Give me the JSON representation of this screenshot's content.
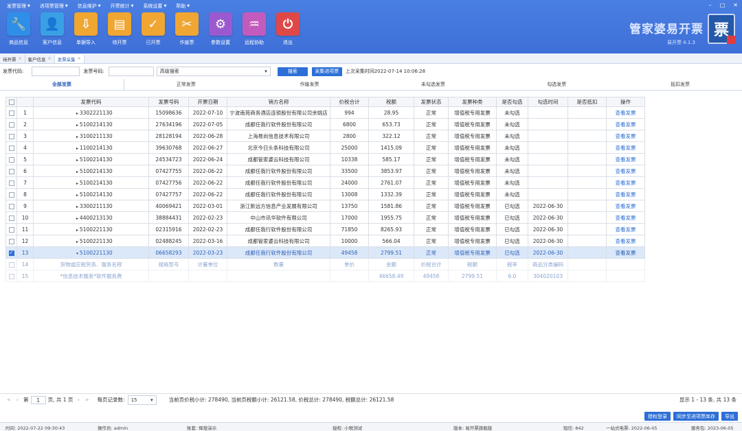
{
  "menu": [
    "发票管理",
    "进项票管理",
    "信息维护",
    "开票统计",
    "系统设置",
    "帮助"
  ],
  "window_controls": [
    "–",
    "□",
    "✕"
  ],
  "toolbar": [
    {
      "label": "商品信息",
      "icon": "wrench-icon",
      "glyph": "🔧",
      "color": "#2f8fe8"
    },
    {
      "label": "客户信息",
      "icon": "user-icon",
      "glyph": "👤",
      "color": "#3aa0e6"
    },
    {
      "label": "单据导入",
      "icon": "import-icon",
      "glyph": "⇩",
      "color": "#f0a632"
    },
    {
      "label": "待开票",
      "icon": "document-icon",
      "glyph": "▤",
      "color": "#f0a632"
    },
    {
      "label": "已开票",
      "icon": "check-icon",
      "glyph": "✓",
      "color": "#f0a632"
    },
    {
      "label": "作废票",
      "icon": "void-icon",
      "glyph": "✂",
      "color": "#f0a632"
    },
    {
      "label": "参数设置",
      "icon": "gear-icon",
      "glyph": "⚙",
      "color": "#9b59d0"
    },
    {
      "label": "远程协助",
      "icon": "monitor-icon",
      "glyph": "♒",
      "color": "#c25bbd"
    },
    {
      "label": "退出",
      "icon": "power-icon",
      "glyph": "⏻",
      "color": "#e04848"
    }
  ],
  "brand": {
    "title": "管家婆易开票",
    "sub": "易开票  4.1.3",
    "logo": "票"
  },
  "tabs": [
    "待开票",
    "客户信息",
    "发票采集"
  ],
  "filter": {
    "code_label": "发票代码:",
    "number_label": "发票号码:",
    "search_mode": "高级搜索",
    "search_btn": "搜索",
    "collect_btn": "采集进项票",
    "last_time": "上次采集时间2022-07-14 10:06:28"
  },
  "categories": [
    "全部发票",
    "正常发票",
    "作废发票",
    "未勾选发票",
    "勾选发票",
    "抵扣发票"
  ],
  "columns": [
    "发票代码",
    "发票号码",
    "开票日期",
    "销方名称",
    "价税合计",
    "税额",
    "发票状态",
    "发票种类",
    "是否勾选",
    "勾选时间",
    "是否抵扣",
    "操作"
  ],
  "rows": [
    [
      "1",
      "3302221130",
      "15098636",
      "2022-07-10",
      "宁波南苑商务酒店连锁股份有限公司余姚店",
      "994",
      "28.95",
      "正常",
      "增值税专用发票",
      "未勾选",
      "",
      "",
      "查看发票"
    ],
    [
      "2",
      "5100214130",
      "27634196",
      "2022-07-05",
      "成都任我行软件股份有限公司",
      "6800",
      "653.73",
      "正常",
      "增值税专用发票",
      "未勾选",
      "",
      "",
      "查看发票"
    ],
    [
      "3",
      "3100211130",
      "28128194",
      "2022-06-28",
      "上海易尚信息技术有限公司",
      "2800",
      "322.12",
      "正常",
      "增值税专用发票",
      "未勾选",
      "",
      "",
      "查看发票"
    ],
    [
      "4",
      "1100214130",
      "39630768",
      "2022-06-27",
      "北京今日头条科技有限公司",
      "25000",
      "1415.09",
      "正常",
      "增值税专用发票",
      "未勾选",
      "",
      "",
      "查看发票"
    ],
    [
      "5",
      "5100214130",
      "24534723",
      "2022-06-24",
      "成都管家婆云科技有限公司",
      "10338",
      "585.17",
      "正常",
      "增值税专用发票",
      "未勾选",
      "",
      "",
      "查看发票"
    ],
    [
      "6",
      "5100214130",
      "07427755",
      "2022-06-22",
      "成都任我行软件股份有限公司",
      "33500",
      "3853.97",
      "正常",
      "增值税专用发票",
      "未勾选",
      "",
      "",
      "查看发票"
    ],
    [
      "7",
      "5100214130",
      "07427756",
      "2022-06-22",
      "成都任我行软件股份有限公司",
      "24000",
      "2761.07",
      "正常",
      "增值税专用发票",
      "未勾选",
      "",
      "",
      "查看发票"
    ],
    [
      "8",
      "5100214130",
      "07427757",
      "2022-06-22",
      "成都任我行软件股份有限公司",
      "13008",
      "1332.39",
      "正常",
      "增值税专用发票",
      "未勾选",
      "",
      "",
      "查看发票"
    ],
    [
      "9",
      "3300211130",
      "40069421",
      "2022-03-01",
      "浙江新远方信息产业发展有限公司",
      "13750",
      "1581.86",
      "正常",
      "增值税专用发票",
      "已勾选",
      "2022-06-30",
      "",
      "查看发票"
    ],
    [
      "10",
      "4400213130",
      "38884431",
      "2022-02-23",
      "中山市讯华软件有限公司",
      "17000",
      "1955.75",
      "正常",
      "增值税专用发票",
      "已勾选",
      "2022-06-30",
      "",
      "查看发票"
    ],
    [
      "11",
      "5100221130",
      "02315916",
      "2022-02-23",
      "成都任我行软件股份有限公司",
      "71850",
      "8265.93",
      "正常",
      "增值税专用发票",
      "已勾选",
      "2022-06-30",
      "",
      "查看发票"
    ],
    [
      "12",
      "5100221130",
      "02488245",
      "2022-03-16",
      "成都管家婆云科技有限公司",
      "10000",
      "566.04",
      "正常",
      "增值税专用发票",
      "已勾选",
      "2022-06-30",
      "",
      "查看发票"
    ],
    [
      "13",
      "5100221130",
      "06658293",
      "2022-03-23",
      "成都任我行软件股份有限公司",
      "49458",
      "2799.51",
      "正常",
      "增值税专用发票",
      "已勾选",
      "2022-06-30",
      "",
      "查看发票"
    ]
  ],
  "sub_header": [
    "14",
    "货物或应税劳务、服务名称",
    "规格型号",
    "计量单位",
    "数量",
    "单价",
    "金额",
    "价税合计",
    "税额",
    "税率",
    "商品分类编码"
  ],
  "sub_row": [
    "15",
    "*信息技术服务*软件服务费",
    "",
    "",
    "",
    "",
    "46658.49",
    "49458",
    "2799.51",
    "6.0",
    "304020103"
  ],
  "pager": {
    "page": "1",
    "total_pages": "页, 共 1 页",
    "per_page_label": "每页记录数:",
    "per_page": "15",
    "summary": "当前页价税小计: 278490,  当前页税额小计: 26121.58,  价税总计: 278490,  税额总计: 26121.58",
    "range": "显示 1 - 13 条, 共 13 条"
  },
  "bottom_buttons": [
    "授权登录",
    "同步至进项票库存",
    "导出"
  ],
  "status": {
    "time": "时间: 2022-07-22 09:30:43",
    "operator": "操作员: admin",
    "account": "账套: 辉煌演示",
    "auth": "授权: 小税测试",
    "version": "版本: 易开票旗舰版",
    "sms": "短信: 842",
    "phone": "一站式电票: 2022-06-05",
    "service": "服务包: 2023-06-05"
  }
}
